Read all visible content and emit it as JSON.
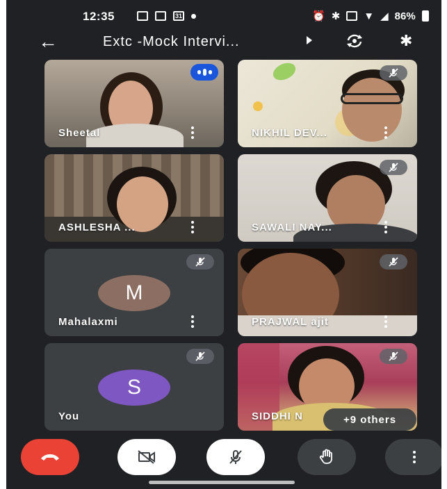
{
  "status_bar": {
    "time": "12:35",
    "calendar_day": "31",
    "battery": "86%"
  },
  "header": {
    "title": "Extc -Mock Intervi...",
    "icons": [
      "back-arrow-icon",
      "caret-right-icon",
      "switch-camera-icon",
      "bluetooth-icon"
    ]
  },
  "participants": [
    {
      "name": "Sheetal",
      "state": "speaking"
    },
    {
      "name": "NIKHIL DEV...",
      "state": "muted"
    },
    {
      "name": "ASHLESHA ...",
      "state": "unmuted"
    },
    {
      "name": "SAWALI NAY...",
      "state": "muted"
    },
    {
      "name": "Mahalaxmi",
      "initial": "M",
      "avatar_color": "#8d6e63",
      "state": "muted"
    },
    {
      "name": "PRAJWAL ajit",
      "state": "muted"
    },
    {
      "name": "You",
      "initial": "S",
      "avatar_color": "#7e57c2",
      "state": "muted"
    },
    {
      "name": "SIDDHI N",
      "state": "muted"
    }
  ],
  "others_label": "+9 others",
  "controls": {
    "end_call_color": "#ea4335",
    "icons": [
      "end-call-icon",
      "camera-off-icon",
      "mic-off-icon",
      "raise-hand-icon",
      "more-options-icon"
    ]
  }
}
